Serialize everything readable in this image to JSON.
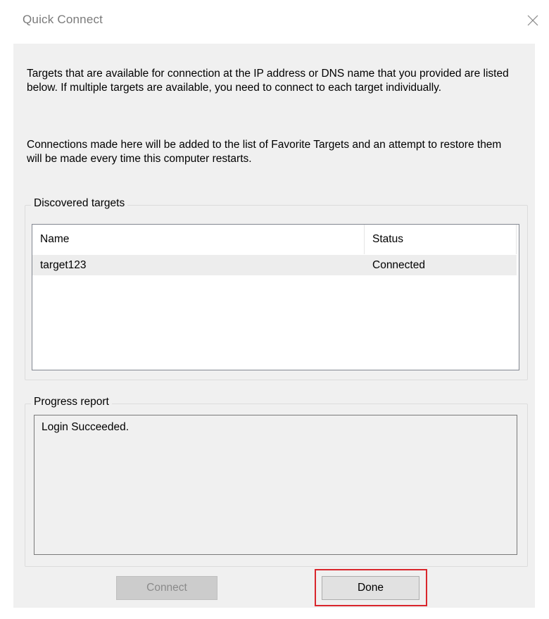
{
  "window": {
    "title": "Quick Connect",
    "close_icon": "close-icon"
  },
  "intro": {
    "paragraph1": "Targets that are available for connection at the IP address or DNS name that you provided are listed below.  If multiple targets are available, you need to connect to each target individually.",
    "paragraph2": "Connections made here will be added to the list of Favorite Targets and an attempt to restore them will be made every time this computer restarts."
  },
  "discovered_targets": {
    "label": "Discovered targets",
    "columns": [
      "Name",
      "Status"
    ],
    "rows": [
      {
        "name": "target123",
        "status": "Connected"
      }
    ]
  },
  "progress_report": {
    "label": "Progress report",
    "text": "Login Succeeded."
  },
  "buttons": {
    "connect_label": "Connect",
    "connect_enabled": false,
    "done_label": "Done"
  },
  "colors": {
    "highlight": "#d9262c",
    "dialog_background": "#f0f0f0",
    "selected_row": "#ededed"
  }
}
